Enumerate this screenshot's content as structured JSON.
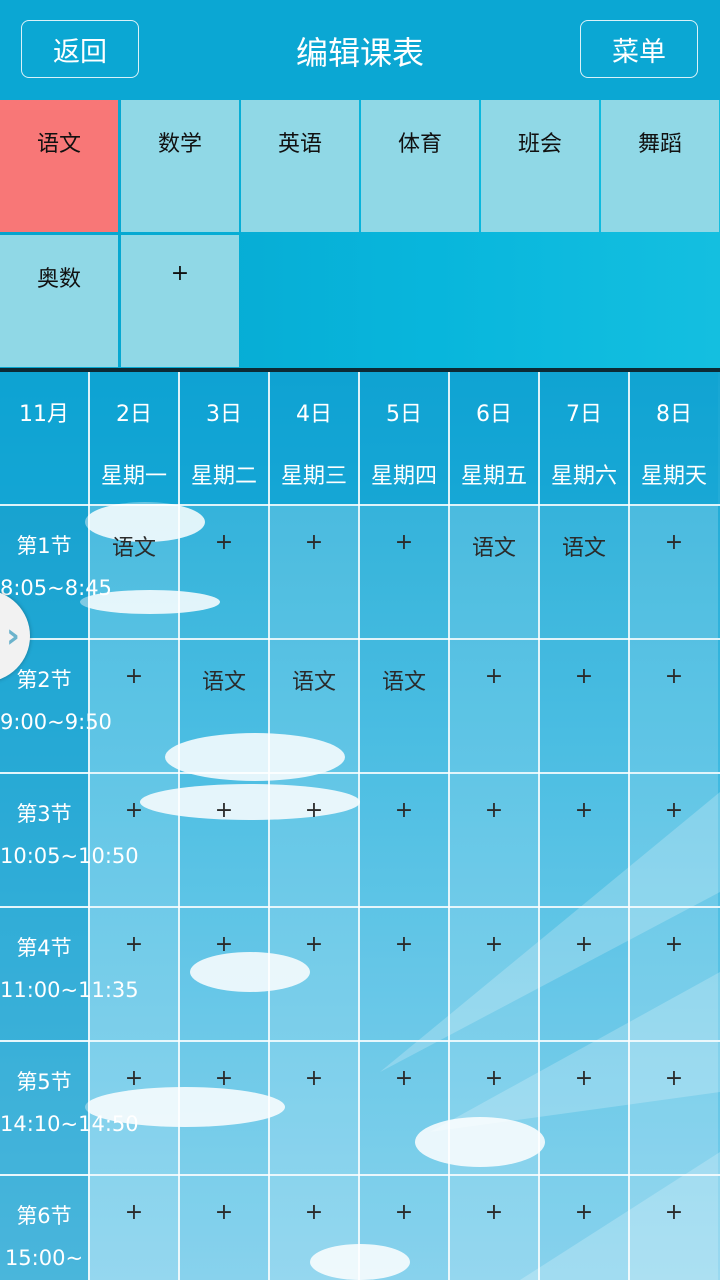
{
  "topbar": {
    "back": "返回",
    "title": "编辑课表",
    "menu": "菜单"
  },
  "subjects": [
    "语文",
    "数学",
    "英语",
    "体育",
    "班会",
    "舞蹈",
    "奥数",
    "+"
  ],
  "selected_subject": "语文",
  "month": "11月",
  "days": [
    {
      "date": "2日",
      "weekday": "星期一"
    },
    {
      "date": "3日",
      "weekday": "星期二"
    },
    {
      "date": "4日",
      "weekday": "星期三"
    },
    {
      "date": "5日",
      "weekday": "星期四"
    },
    {
      "date": "6日",
      "weekday": "星期五"
    },
    {
      "date": "7日",
      "weekday": "星期六"
    },
    {
      "date": "8日",
      "weekday": "星期天"
    }
  ],
  "periods": [
    {
      "name": "第1节",
      "time": "8:05~8:45",
      "cells": [
        "语文",
        "+",
        "+",
        "+",
        "语文",
        "语文",
        "+"
      ]
    },
    {
      "name": "第2节",
      "time": "9:00~9:50",
      "cells": [
        "+",
        "语文",
        "语文",
        "语文",
        "+",
        "+",
        "+"
      ]
    },
    {
      "name": "第3节",
      "time": "10:05~10:50",
      "cells": [
        "+",
        "+",
        "+",
        "+",
        "+",
        "+",
        "+"
      ]
    },
    {
      "name": "第4节",
      "time": "11:00~11:35",
      "cells": [
        "+",
        "+",
        "+",
        "+",
        "+",
        "+",
        "+"
      ]
    },
    {
      "name": "第5节",
      "time": "14:10~14:50",
      "cells": [
        "+",
        "+",
        "+",
        "+",
        "+",
        "+",
        "+"
      ]
    },
    {
      "name": "第6节",
      "time": "15:00~",
      "cells": [
        "+",
        "+",
        "+",
        "+",
        "+",
        "+",
        "+"
      ]
    }
  ],
  "drawer_handle": "›"
}
